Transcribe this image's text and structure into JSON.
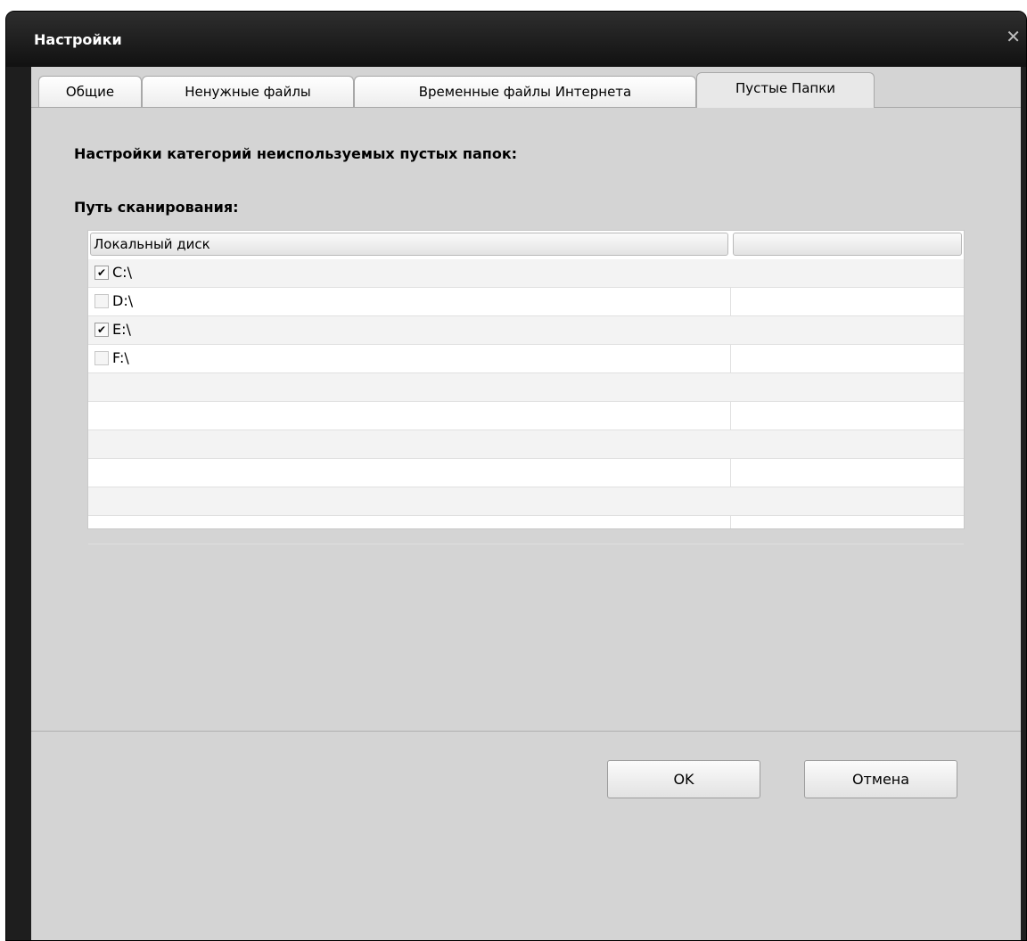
{
  "window": {
    "title": "Настройки",
    "close_glyph": "✕"
  },
  "tabs": [
    {
      "label": "Общие"
    },
    {
      "label": "Ненужные файлы"
    },
    {
      "label": "Временные файлы Интернета"
    },
    {
      "label": "Пустые Папки",
      "selected": true
    }
  ],
  "panel": {
    "heading": "Настройки категорий неиспользуемых пустых папок:",
    "scan_path_label": "Путь сканирования:"
  },
  "table": {
    "columns": [
      "Локальный диск",
      ""
    ],
    "rows": [
      {
        "label": "C:\\",
        "checked": true
      },
      {
        "label": "D:\\",
        "checked": false
      },
      {
        "label": "E:\\",
        "checked": true
      },
      {
        "label": "F:\\",
        "checked": false
      }
    ],
    "check_glyph": "✔"
  },
  "buttons": {
    "ok": "OK",
    "cancel": "Отмена"
  }
}
